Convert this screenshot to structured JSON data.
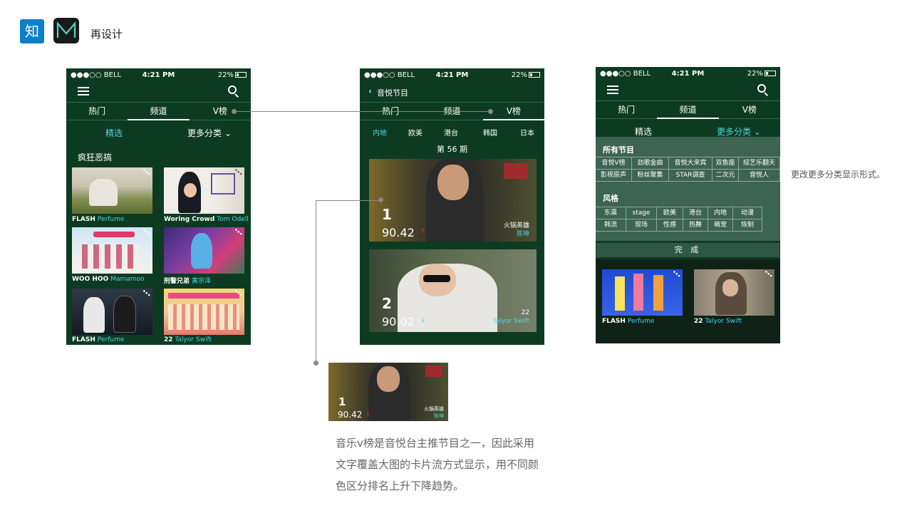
{
  "header": {
    "logo_zhi": "知",
    "title": "再设计"
  },
  "status": {
    "carrier": "●●●○○ BELL",
    "time": "4:21 PM",
    "battery": "22%"
  },
  "tabs": [
    "热门",
    "频道",
    "V榜"
  ],
  "phone1": {
    "sub_left": "精选",
    "sub_right": "更多分类",
    "section": "疯狂恶搞",
    "items": [
      {
        "title": "FLASH",
        "artist": "Perfume"
      },
      {
        "title": "Woring Crowd",
        "artist": "Tom Odell"
      },
      {
        "title": "WOO HOO",
        "artist": "Mamamoo"
      },
      {
        "title": "刑警兄弟",
        "artist": "黄宗泽"
      },
      {
        "title": "FLASH",
        "artist": "Perfume"
      },
      {
        "title": "22",
        "artist": "Talyor Swift"
      }
    ]
  },
  "phone2": {
    "nav_title": "音悦节目",
    "regions": [
      "内地",
      "欧美",
      "港台",
      "韩国",
      "日本"
    ],
    "issue": "第 56 期",
    "cards": [
      {
        "rank": "1",
        "score": "90.42",
        "trend": "↑",
        "title": "火锅英雄",
        "artist": "陈坤"
      },
      {
        "rank": "2",
        "score": "90.02",
        "trend": "↓",
        "title": "22",
        "artist": "Talyor Swift"
      }
    ]
  },
  "phone3": {
    "sub_left": "精选",
    "sub_right": "更多分类",
    "all_title": "所有节目",
    "all_items": [
      "音悦V榜",
      "劲歌金曲",
      "音悦大来宾",
      "双鱼座",
      "综艺乐翻天",
      "影视原声",
      "粉丝聚集",
      "STAR调查",
      "二次元",
      "音悦人"
    ],
    "style_title": "风格",
    "style_items": [
      "东瀛",
      "stage",
      "欧美",
      "港台",
      "内地",
      "动漫",
      "韩流",
      "现场",
      "性感",
      "热舞",
      "萌宠",
      "恢制"
    ],
    "done": "完 成",
    "items": [
      {
        "title": "FLASH",
        "artist": "Perfume"
      },
      {
        "title": "22",
        "artist": "Talyor Swift"
      }
    ]
  },
  "zoom_card": {
    "rank": "1",
    "score": "90.42",
    "trend": "↑",
    "title": "火锅英雄",
    "artist": "陈坤"
  },
  "caption": {
    "line1": "音乐v榜是音悦台主推节目之一，因此采用",
    "line2": "文字覆盖大图的卡片流方式显示，用不同颜",
    "line3": "色区分排名上升下降趋势。"
  },
  "note": "更改更多分类显示形式。",
  "colors": {
    "bg": "#0d3b22",
    "accent": "#4fd4e3",
    "up": "#e0312b",
    "zhi": "#0d7ec9"
  }
}
